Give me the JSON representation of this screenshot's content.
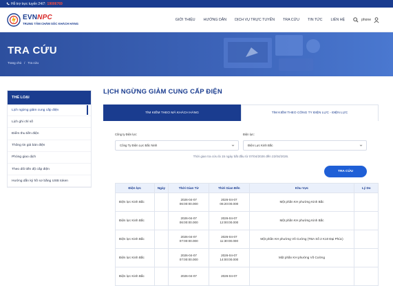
{
  "topbar": {
    "hotline_label": "Hỗ trợ trực tuyến 24/7:",
    "hotline_number": "19006769"
  },
  "logo": {
    "brand_main": "EVN",
    "brand_accent": "NPC",
    "tagline": "TRUNG TÂM CHĂM SÓC KHÁCH HÀNG"
  },
  "nav": {
    "items": [
      "GIỚI THIỆU",
      "HƯỚNG DẪN",
      "DỊCH VỤ TRỰC TUYẾN",
      "TRA CỨU",
      "TIN TỨC",
      "LIÊN HỆ"
    ],
    "search_placeholder": "phone"
  },
  "hero": {
    "title": "TRA CỨU",
    "breadcrumb": [
      "Trang chủ",
      "/",
      "Tra cứu"
    ]
  },
  "sidebar": {
    "title": "THỂ LOẠI",
    "items": [
      "Lịch ngừng giảm cung cấp điện",
      "Lịch ghi chỉ số",
      "Điểm thu tiền điện",
      "Thông tin giá bán điện",
      "Phòng giao dịch",
      "Theo dõi tiến độ cấp điện",
      "Hướng dẫn ký hồ sơ bằng USB token"
    ]
  },
  "main": {
    "title": "LỊCH NGỪNG GIẢM CUNG CẤP ĐIỆN",
    "tabs": [
      "TÌM KIẾM THEO MÃ KHÁCH HÀNG",
      "TÌM KIẾM THEO CÔNG TY ĐIỆN LỰC - ĐIỆN LỰC"
    ],
    "form": {
      "company_label": "Công ty Điện lực:",
      "company_value": "Công Ty Điện Lực Bắc Ninh",
      "branch_label": "Điện lực:",
      "branch_value": "Điện Lực Kinh Bắc",
      "note": "Thời gian tra cứu là 15 ngày bắt đầu từ 07/04/2026 đến 22/04/2026.",
      "submit_label": "TRA CỨU"
    },
    "table": {
      "headers": [
        "Điện lực",
        "Ngày",
        "Thời Gian Từ",
        "Thời Gian Đến",
        "Khu Vực",
        "Lý Do"
      ],
      "rows": [
        {
          "branch": "Điện lực Kinh Bắc",
          "date": "",
          "from_date": "2026-04-07",
          "from_time": "06:00:00.000",
          "to_date": "2026-04-07",
          "to_time": "06:20:00.000",
          "area": "Một phần KH phường Kinh Bắc",
          "reason": ""
        },
        {
          "branch": "Điện lực Kinh Bắc",
          "date": "",
          "from_date": "2026-04-07",
          "from_time": "06:00:00.000",
          "to_date": "2026-04-07",
          "to_time": "12:00:00.000",
          "area": "Một phần KH phường Kinh Bắc",
          "reason": ""
        },
        {
          "branch": "Điện lực Kinh Bắc",
          "date": "",
          "from_date": "2026-04-07",
          "from_time": "07:00:00.000",
          "to_date": "2026-04-07",
          "to_time": "11:30:00.000",
          "area": "Một phần KH phường Võ Cường (TBA Số 2 K10 Đại Phúc)",
          "reason": ""
        },
        {
          "branch": "Điện lực Kinh Bắc",
          "date": "",
          "from_date": "2026-04-07",
          "from_time": "07:00:00.000",
          "to_date": "2026-04-07",
          "to_time": "14:00:00.000",
          "area": "Một phần KH phường Võ Cường",
          "reason": ""
        },
        {
          "branch": "Điện lực Kinh Bắc",
          "date": "",
          "from_date": "2026-04-07",
          "from_time": "",
          "to_date": "2026-04-07",
          "to_time": "",
          "area": "",
          "reason": ""
        }
      ]
    }
  },
  "colors": {
    "primary": "#1a3c8f",
    "accent_red": "#d82a2a",
    "button_blue": "#1f5fd6",
    "hotline": "#ff4d3d"
  }
}
